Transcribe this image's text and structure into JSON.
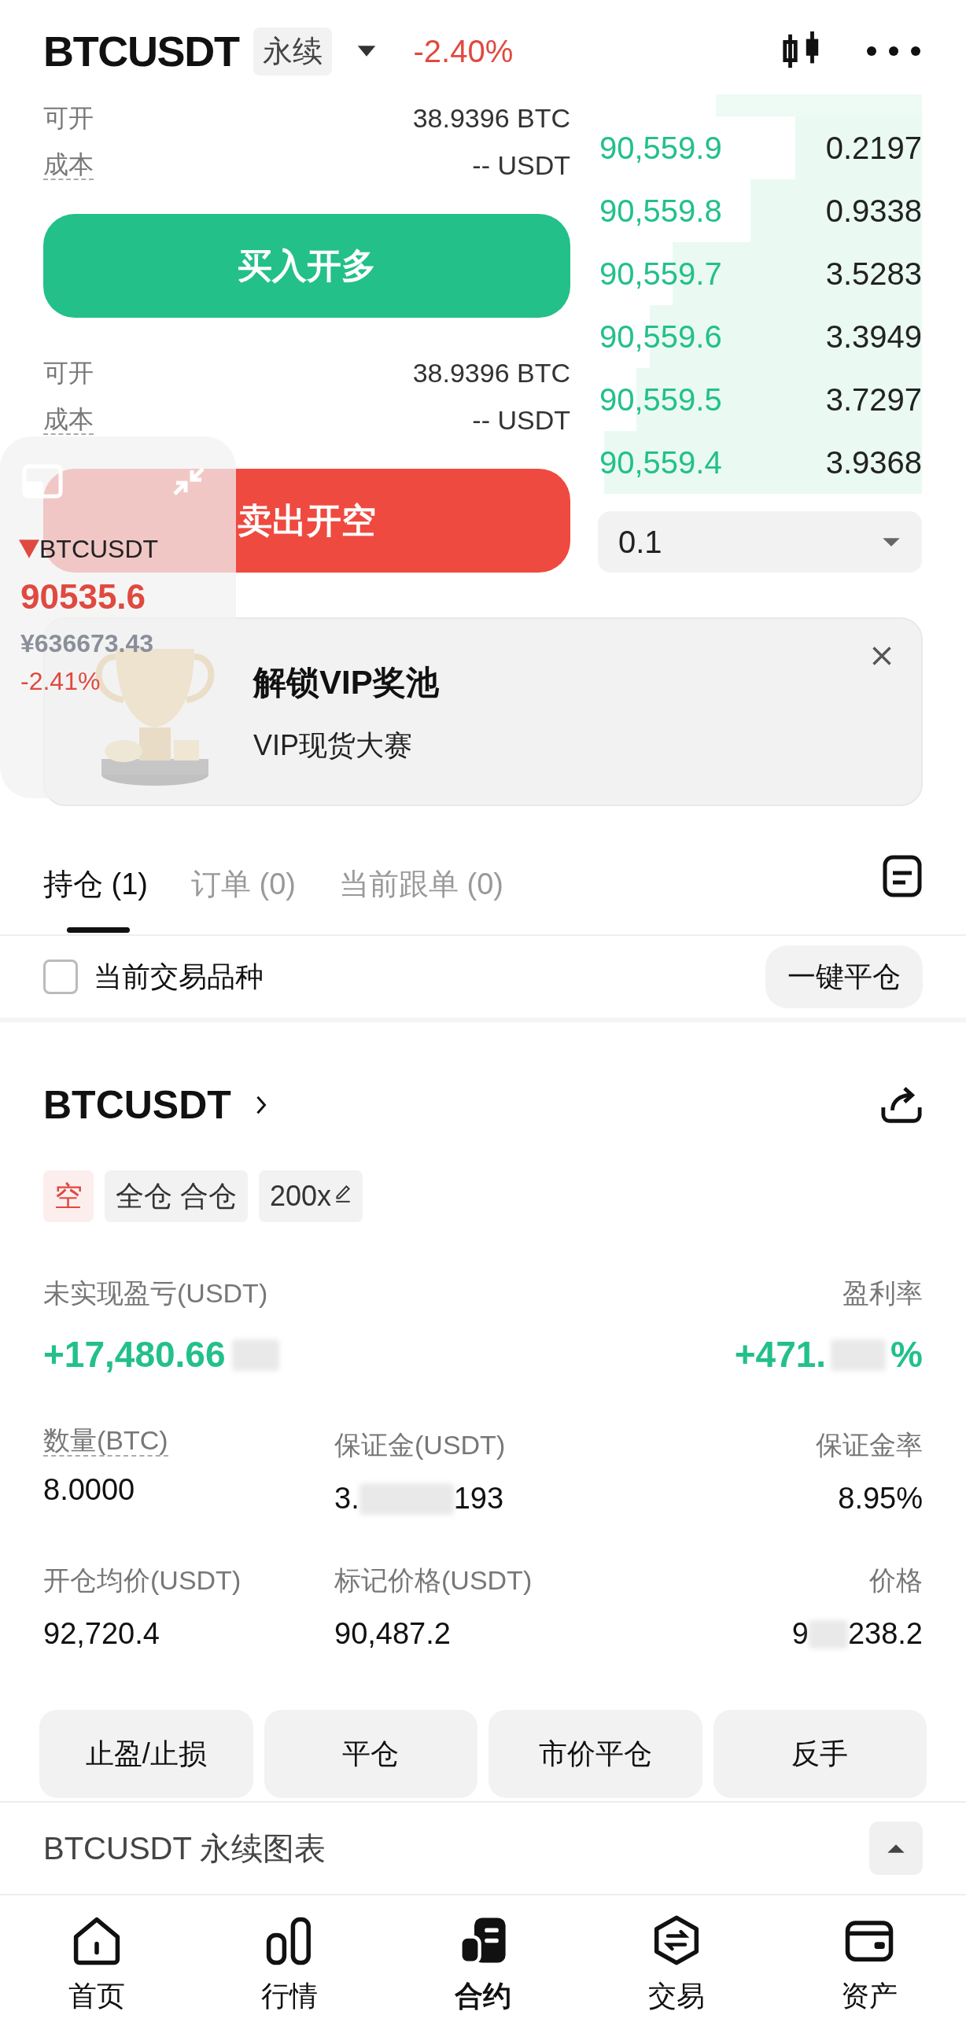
{
  "header": {
    "symbol": "BTCUSDT",
    "tag": "永续",
    "change": "-2.40%"
  },
  "buy_panel": {
    "rows": [
      {
        "label": "可开",
        "value": "38.9396 BTC"
      },
      {
        "label": "成本",
        "value": "-- USDT"
      }
    ],
    "button": "买入开多"
  },
  "sell_panel": {
    "rows": [
      {
        "label": "可开",
        "value": "38.9396 BTC"
      },
      {
        "label": "成本",
        "value": "-- USDT"
      }
    ],
    "button": "卖出开空"
  },
  "order_book": {
    "rows": [
      {
        "price": "90,559.9",
        "amount": "0.2197"
      },
      {
        "price": "90,559.8",
        "amount": "0.9338"
      },
      {
        "price": "90,559.7",
        "amount": "3.5283"
      },
      {
        "price": "90,559.6",
        "amount": "3.3949"
      },
      {
        "price": "90,559.5",
        "amount": "3.7297"
      },
      {
        "price": "90,559.4",
        "amount": "3.9368"
      }
    ],
    "step": "0.1"
  },
  "float_ticker": {
    "symbol": "BTCUSDT",
    "price": "90535.6",
    "fiat": "¥636673.43",
    "change": "-2.41%"
  },
  "banner": {
    "title": "解锁VIP奖池",
    "subtitle": "VIP现货大赛"
  },
  "tabs": [
    {
      "label": "持仓 (1)",
      "selected": true
    },
    {
      "label": "订单 (0)",
      "selected": false
    },
    {
      "label": "当前跟单 (0)",
      "selected": false
    }
  ],
  "filter": {
    "label": "当前交易品种",
    "checked": false,
    "button": "一键平仓"
  },
  "position": {
    "symbol": "BTCUSDT",
    "tags": [
      {
        "label": "空",
        "kind": "side"
      },
      {
        "label": "全仓 合仓",
        "kind": "plain"
      },
      {
        "label": "200x",
        "kind": "leverage"
      }
    ],
    "pnl_label": "未实现盈亏(USDT)",
    "pnl": "+17,480.66",
    "roe_label": "盈利率",
    "roe": "+471.",
    "roe_unit": "%",
    "stats": [
      {
        "label": "数量(BTC)",
        "value": "8.0000",
        "dashed": true
      },
      {
        "label": "保证金(USDT)",
        "value": "3.",
        "value_tail": "193",
        "dashed": false
      },
      {
        "label": "保证金率",
        "value": "8.95%",
        "dashed": false
      },
      {
        "label": "开仓均价(USDT)",
        "value": "92,720.4",
        "dashed": false
      },
      {
        "label": "标记价格(USDT)",
        "value": "90,487.2",
        "dashed": false
      },
      {
        "label": "价格",
        "value": "238.2",
        "value_head": "9",
        "dashed": false
      }
    ],
    "actions": [
      "止盈/止损",
      "平仓",
      "市价平仓",
      "反手"
    ]
  },
  "chart_bar": {
    "title": "BTCUSDT 永续图表"
  },
  "nav": [
    {
      "label": "首页",
      "kind": "home",
      "selected": false
    },
    {
      "label": "行情",
      "kind": "market",
      "selected": false
    },
    {
      "label": "合约",
      "kind": "futures",
      "selected": true
    },
    {
      "label": "交易",
      "kind": "trade",
      "selected": false
    },
    {
      "label": "资产",
      "kind": "assets",
      "selected": false
    }
  ]
}
